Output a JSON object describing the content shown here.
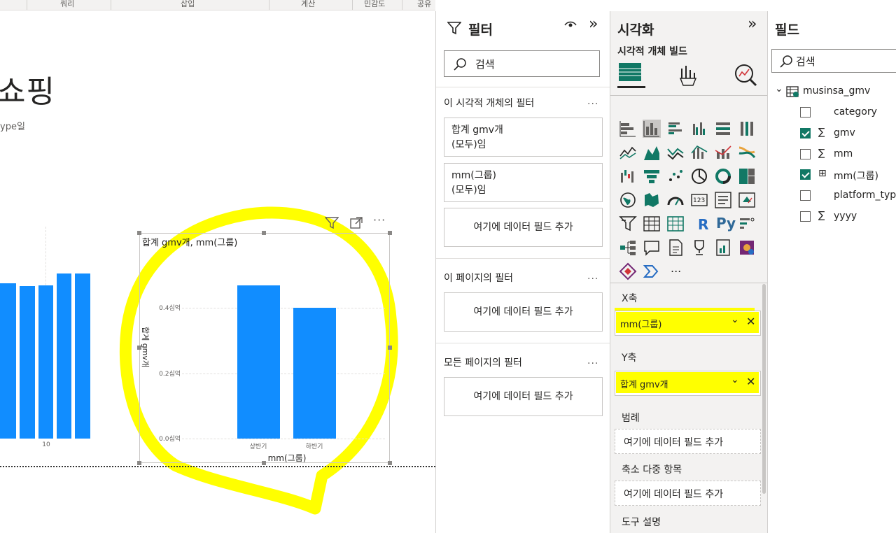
{
  "ribbon": {
    "tabs": [
      "쿼리",
      "삽입",
      "계산",
      "민감도",
      "공유"
    ]
  },
  "canvas": {
    "title": "쇼핑",
    "subtitle": "ype일",
    "left_chart": {
      "xtick": "10"
    },
    "chart2": {
      "title": "합계 gmv개, mm(그룹)",
      "ylabel": "합계 gmv개",
      "xlabel": "mm(그룹)",
      "yticks": [
        "0.4십억",
        "0.2십억",
        "0.0십억"
      ]
    }
  },
  "chart_data": {
    "type": "bar",
    "title": "합계 gmv개, mm(그룹)",
    "xlabel": "mm(그룹)",
    "ylabel": "합계 gmv개",
    "categories": [
      "상반기",
      "하반기"
    ],
    "values": [
      0.47,
      0.4
    ],
    "ylim": [
      0,
      0.48
    ],
    "yticks": [
      "0.0십억",
      "0.2십억",
      "0.4십억"
    ],
    "grid": true,
    "color": "#118dff"
  },
  "filters": {
    "title": "필터",
    "search_placeholder": "검색",
    "visual_section": "이 시각적 개체의 필터",
    "card1_line1": "합계 gmv개",
    "card1_line2": "(모두)임",
    "card2_line1": "mm(그룹)",
    "card2_line2": "(모두)임",
    "add_field": "여기에 데이터 필드 추가",
    "page_section": "이 페이지의 필터",
    "all_pages_section": "모든 페이지의 필터",
    "more": "..."
  },
  "viz": {
    "title": "시각화",
    "subtitle": "시각적 개체 빌드",
    "more_visuals": "...",
    "x_axis_label": "X축",
    "x_axis_value": "mm(그룹)",
    "y_axis_label": "Y축",
    "y_axis_value": "합계 gmv개",
    "legend_label": "범례",
    "small_multiples_label": "축소 다중 항목",
    "tooltip_label": "도구 설명",
    "add_field": "여기에 데이터 필드 추가",
    "r_label": "R",
    "py_label": "Py",
    "num_label": "123"
  },
  "fields": {
    "title": "필드",
    "search_placeholder": "검색",
    "table": "musinsa_gmv",
    "items": [
      {
        "label": "category",
        "checked": false,
        "sigma": ""
      },
      {
        "label": "gmv",
        "checked": true,
        "sigma": "∑"
      },
      {
        "label": "mm",
        "checked": false,
        "sigma": "∑"
      },
      {
        "label": "mm(그룹)",
        "checked": true,
        "sigma": "⊞"
      },
      {
        "label": "platform_type",
        "checked": false,
        "sigma": ""
      },
      {
        "label": "yyyy",
        "checked": false,
        "sigma": "∑"
      }
    ]
  },
  "colors": {
    "accent": "#118dff",
    "highlight": "#ffff00",
    "check": "#117865"
  }
}
